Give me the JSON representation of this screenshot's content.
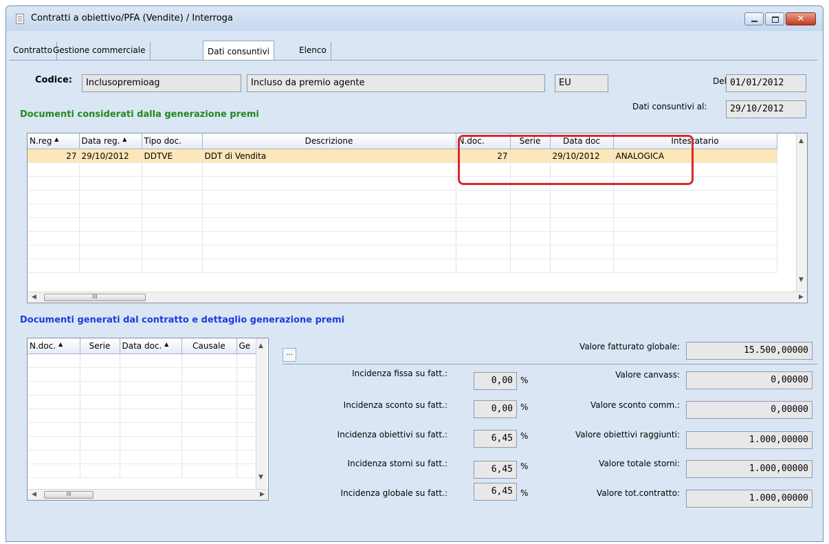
{
  "window": {
    "title": "Contratti a obiettivo/PFA (Vendite) / Interroga",
    "close_label": "✕"
  },
  "tabs": [
    "Contratto",
    "Gestione commerciale",
    "Dati consuntivi",
    "Elenco"
  ],
  "header": {
    "codice_label": "Codice:",
    "codice_value": "Inclusopremioag",
    "descrizione_value": "Incluso da premio agente",
    "valuta_value": "EU",
    "del_label": "Del:",
    "del_value": "01/01/2012",
    "consuntivi_label": "Dati consuntivi al:",
    "consuntivi_value": "29/10/2012"
  },
  "section1": {
    "title": "Documenti considerati dalla generazione premi",
    "title_color": "#1e8a1e",
    "columns": [
      "N.reg",
      "Data reg.",
      "Tipo doc.",
      "Descrizione",
      "N.doc.",
      "Serie",
      "Data doc",
      "Intestatario"
    ],
    "col_sort": [
      "1",
      "2",
      "",
      "",
      "",
      "",
      "",
      ""
    ],
    "rows": [
      [
        "27",
        "29/10/2012",
        "DDTVE",
        "DDT di Vendita",
        "27",
        "",
        "29/10/2012",
        "ANALOGICA"
      ]
    ],
    "scroll_thumb": "III"
  },
  "section2": {
    "title": "Documenti generati dal contratto e dettaglio generazione premi",
    "title_color": "#1a3cdc",
    "columns": [
      "N.doc.",
      "Serie",
      "Data doc.",
      "Causale",
      "Ge"
    ],
    "col_sort": [
      "2",
      "",
      "3",
      "",
      ""
    ],
    "scroll_thumb": "III",
    "dots_label": "..."
  },
  "incidenze": [
    {
      "label": "Incidenza fissa su fatt.:",
      "value": "0,00",
      "unit": "%"
    },
    {
      "label": "Incidenza sconto su fatt.:",
      "value": "0,00",
      "unit": "%"
    },
    {
      "label": "Incidenza obiettivi su fatt.:",
      "value": "6,45",
      "unit": "%"
    },
    {
      "label": "Incidenza storni su fatt.:",
      "value": "6,45",
      "unit": "%"
    },
    {
      "label": "Incidenza globale su fatt.:",
      "value": "6,45",
      "unit": "%"
    }
  ],
  "valori": [
    {
      "label": "Valore fatturato globale:",
      "value": "15.500,00000"
    },
    {
      "label": "Valore canvass:",
      "value": "0,00000"
    },
    {
      "label": "Valore sconto comm.:",
      "value": "0,00000"
    },
    {
      "label": "Valore obiettivi raggiunti:",
      "value": "1.000,00000"
    },
    {
      "label": "Valore totale storni:",
      "value": "1.000,00000"
    },
    {
      "label": "Valore tot.contratto:",
      "value": "1.000,00000"
    }
  ]
}
